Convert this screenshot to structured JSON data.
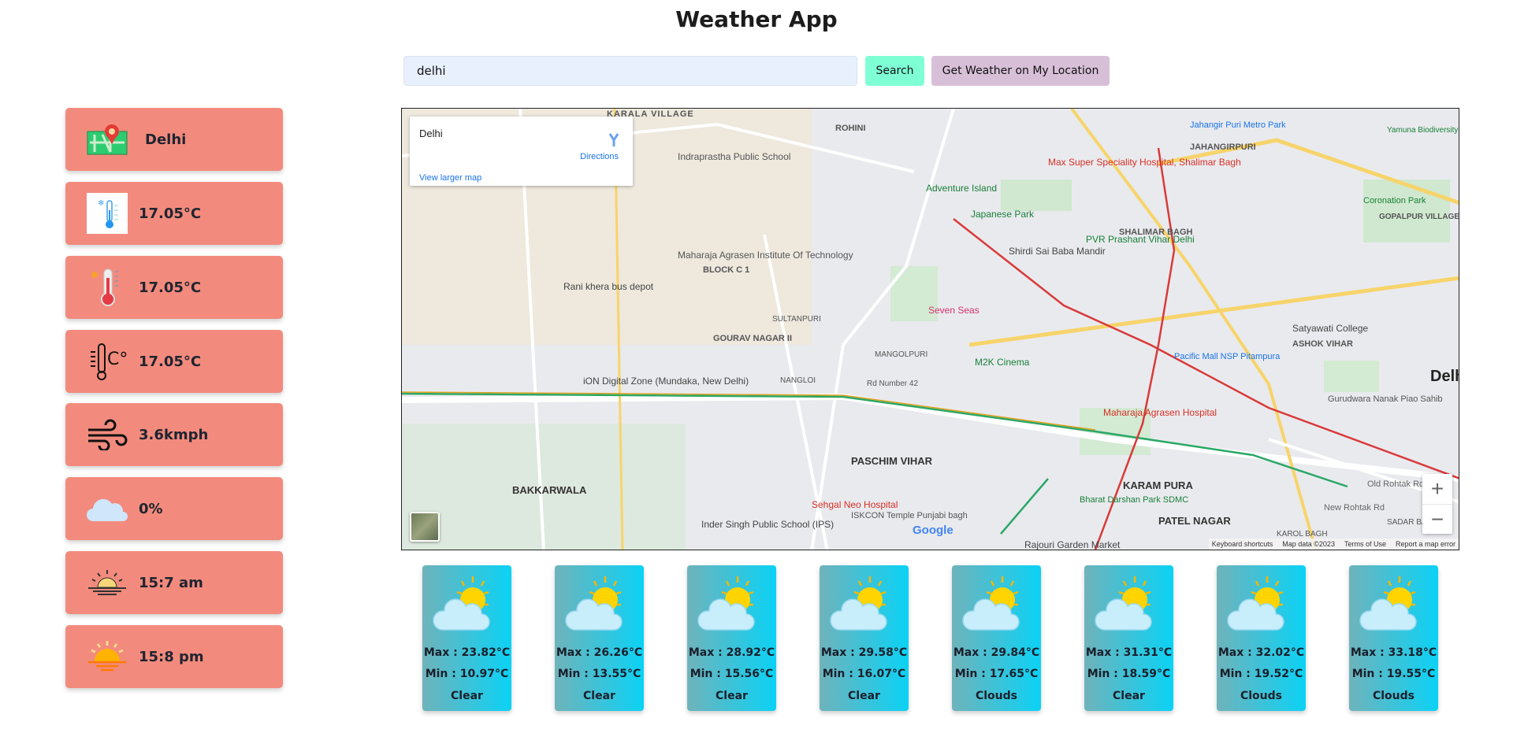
{
  "header": {
    "title": "Weather App"
  },
  "search": {
    "value": "delhi",
    "search_label": "Search",
    "location_label": "Get Weather on My Location"
  },
  "current": {
    "city": "Delhi",
    "temp": "17.05°C",
    "feels_like": "17.05°C",
    "temp_alt": "17.05°C",
    "wind": "3.6kmph",
    "clouds": "0%",
    "sunrise": "15:7 am",
    "sunset": "15:8 pm"
  },
  "map": {
    "place": "Delhi",
    "directions": "Directions",
    "view_larger": "View larger map",
    "zoom_in": "+",
    "zoom_out": "−",
    "google": "Google",
    "attribution": [
      "Keyboard shortcuts",
      "Map data ©2023",
      "Terms of Use",
      "Report a map error"
    ],
    "labels": [
      "KARALA VILLAGE",
      "ROHINI",
      "JAHANGIRPURI",
      "SHALIMAR BAGH",
      "BLOCK C 1",
      "GOURAV NAGAR II",
      "PASCHIM VIHAR",
      "KARAM PURA",
      "PATEL NAGAR",
      "BAKKARWALA",
      "ASHOK VIHAR",
      "Delhi",
      "Maharaja Agrasen Hospital",
      "Sehgal Neo Hospital",
      "Seven Seas",
      "Rani khera bus depot",
      "Japanese Park",
      "Adventure Island",
      "M2K Cinema",
      "Satyawati College",
      "Pacific Mall NSP Pitampura",
      "Rajouri Garden Market",
      "Max Super Speciality Hospital, Shalimar Bagh",
      "Jahangir Puri Metro Park",
      "Indraprastha Public School",
      "Maharaja Agrasen Institute Of Technology",
      "Shirdi Sai Baba Mandir",
      "PVR Prashant Vihar Delhi",
      "iON Digital Zone (Mundaka, New Delhi)",
      "Inder Singh Public School (IPS)",
      "ISKCON Temple Punjabi bagh",
      "Bharat Darshan Park SDMC",
      "Coronation Park",
      "Gurudwara Nanak Piao Sahib",
      "Old Rohtak Rd",
      "New Rohtak Rd",
      "Rd Number 42",
      "MANGOLPURI",
      "SULTANPURI",
      "NANGLOI",
      "KAROL BAGH",
      "SADAR BAZAR",
      "GOPALPUR VILLAGE",
      "Yamuna Biodiversity Park"
    ]
  },
  "forecast": [
    {
      "max": "Max : 23.82°C",
      "min": "Min : 10.97°C",
      "condition": "Clear"
    },
    {
      "max": "Max : 26.26°C",
      "min": "Min : 13.55°C",
      "condition": "Clear"
    },
    {
      "max": "Max : 28.92°C",
      "min": "Min : 15.56°C",
      "condition": "Clear"
    },
    {
      "max": "Max : 29.58°C",
      "min": "Min : 16.07°C",
      "condition": "Clear"
    },
    {
      "max": "Max : 29.84°C",
      "min": "Min : 17.65°C",
      "condition": "Clouds"
    },
    {
      "max": "Max : 31.31°C",
      "min": "Min : 18.59°C",
      "condition": "Clear"
    },
    {
      "max": "Max : 32.02°C",
      "min": "Min : 19.52°C",
      "condition": "Clouds"
    },
    {
      "max": "Max : 33.18°C",
      "min": "Min : 19.55°C",
      "condition": "Clouds"
    }
  ],
  "colors": {
    "card": "#f28b7d",
    "search_btn": "#7fffd4",
    "location_btn": "#d8bfd8",
    "input_bg": "#e8f0fe"
  }
}
